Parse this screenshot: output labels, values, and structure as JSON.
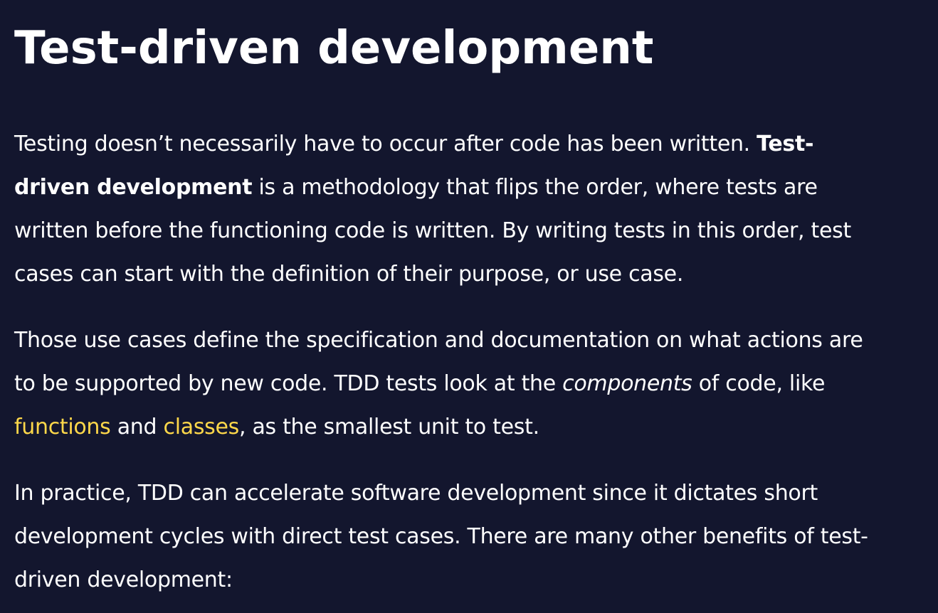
{
  "heading": "Test-driven development",
  "paragraph_1": {
    "line_1_text": "Testing doesn’t necessarily have to occur after code has been written. ",
    "line_1_bold": "Test-",
    "line_2_bold": "driven development",
    "line_2_text": " is a methodology that flips the order, where tests are",
    "line_3": "written before the functioning code is written. By writing tests in this order, test",
    "line_4": "cases can start with the definition of their purpose, or use case."
  },
  "paragraph_2": {
    "line_1": "Those use cases define the specification and documentation on what actions are",
    "line_2_before": "to be supported by new code. TDD tests look at the ",
    "line_2_italic": "components",
    "line_2_after": " of code, like",
    "link_functions": "functions",
    "and_text": " and ",
    "link_classes": "classes",
    "line_3_after": ", as the smallest unit to test."
  },
  "paragraph_3": {
    "line_1": "In practice, TDD can accelerate software development since it dictates short",
    "line_2": "development cycles with direct test cases. There are many other benefits of test-",
    "line_3": "driven development:"
  },
  "colors": {
    "background": "#13162e",
    "text": "#ffffff",
    "link": "#ffd84a"
  }
}
